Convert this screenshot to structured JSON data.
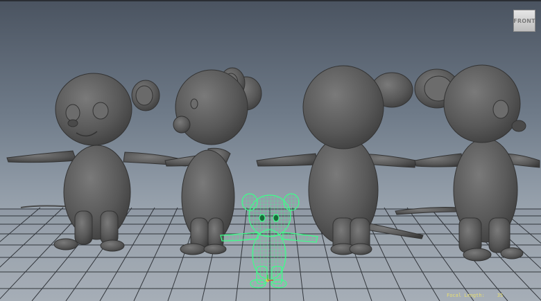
{
  "viewport": {
    "view_cube_label": "FRONT",
    "hud": {
      "focal_length_label": "Focal Length:",
      "focal_length_value": "35"
    }
  },
  "colors": {
    "background_top": "#4a5360",
    "background_bottom": "#b3bbc3",
    "grid": "#1f2227",
    "model_gray": "#5a5a5a",
    "selection_wireframe": "#3dff8a",
    "hud_text": "#e8df6f"
  }
}
